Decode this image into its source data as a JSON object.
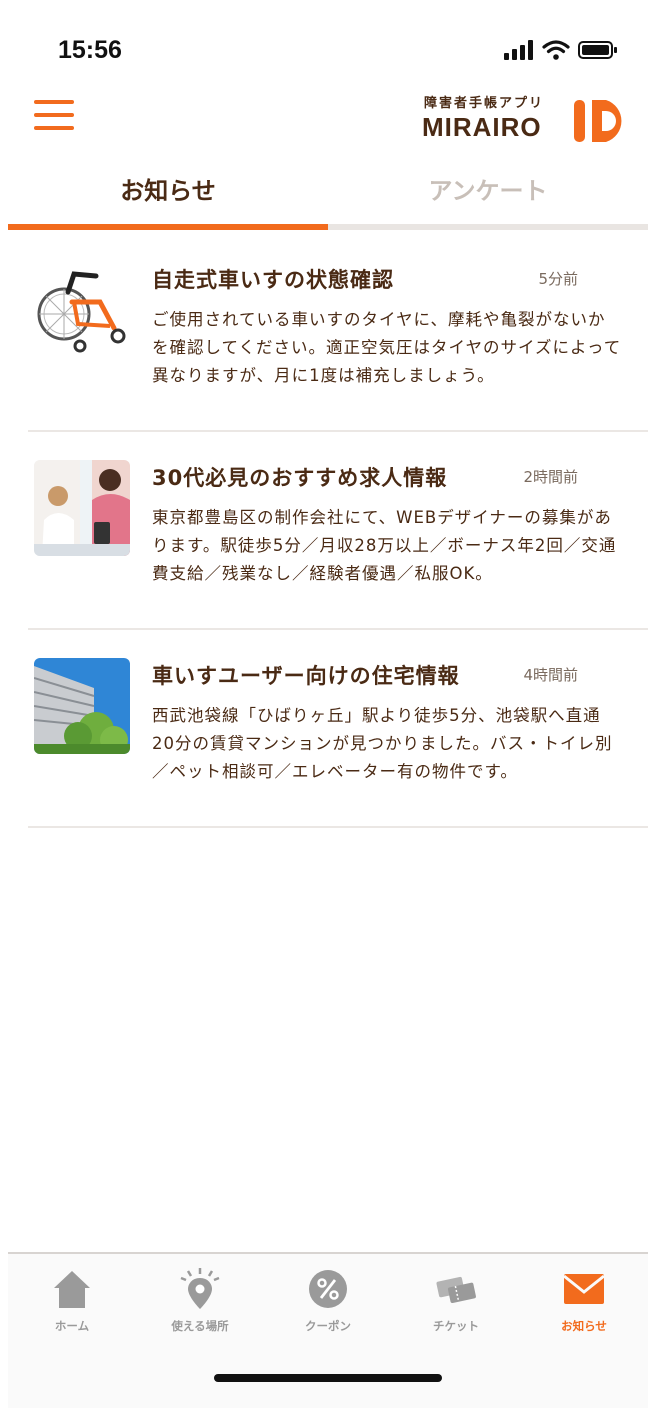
{
  "status_bar": {
    "time": "15:56"
  },
  "header": {
    "logo_subtitle": "障害者手帳アプリ",
    "logo_main": "MIRAIRO",
    "logo_id": "ID"
  },
  "tabs": [
    {
      "label": "お知らせ",
      "active": true
    },
    {
      "label": "アンケート",
      "active": false
    }
  ],
  "notices": [
    {
      "title": "自走式車いすの状態確認",
      "time": "5分前",
      "body": "ご使用されている車いすのタイヤに、摩耗や亀裂がないかを確認してください。適正空気圧はタイヤのサイズによって異なりますが、月に1度は補充しましょう。",
      "thumbnail": "wheelchair-photo"
    },
    {
      "title": "30代必見のおすすめ求人情報",
      "time": "2時間前",
      "body": "東京都豊島区の制作会社にて、WEBデザイナーの募集があります。駅徒歩5分／月収28万以上／ボーナス年2回／交通費支給／残業なし／経験者優遇／私服OK。",
      "thumbnail": "office-workers-photo"
    },
    {
      "title": "車いすユーザー向けの住宅情報",
      "time": "4時間前",
      "body": "西武池袋線「ひばりヶ丘」駅より徒歩5分、池袋駅へ直通20分の賃貸マンションが見つかりました。バス・トイレ別／ペット相談可／エレベーター有の物件です。",
      "thumbnail": "apartment-building-photo"
    }
  ],
  "bottom_nav": [
    {
      "label": "ホーム",
      "icon": "home-icon",
      "active": false
    },
    {
      "label": "使える場所",
      "icon": "location-pin-icon",
      "active": false
    },
    {
      "label": "クーポン",
      "icon": "coupon-percent-icon",
      "active": false
    },
    {
      "label": "チケット",
      "icon": "ticket-icon",
      "active": false
    },
    {
      "label": "お知らせ",
      "icon": "mail-icon",
      "active": true
    }
  ],
  "colors": {
    "accent": "#f26b1d",
    "text_brown": "#4a2a14",
    "inactive_gray": "#9a9a9a"
  }
}
